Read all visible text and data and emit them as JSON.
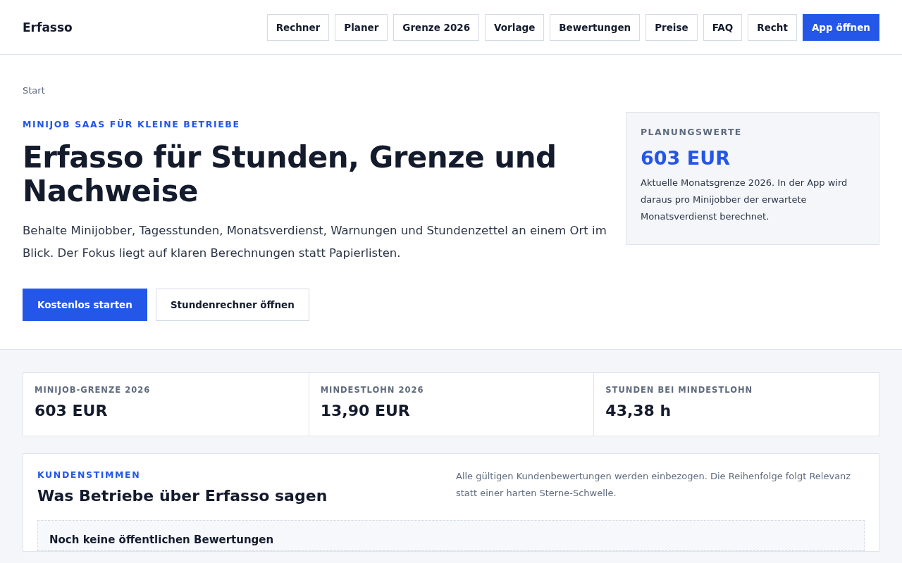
{
  "header": {
    "brand": "Erfasso",
    "nav": [
      {
        "label": "Rechner",
        "kind": "outline"
      },
      {
        "label": "Planer",
        "kind": "outline"
      },
      {
        "label": "Grenze 2026",
        "kind": "outline"
      },
      {
        "label": "Vorlage",
        "kind": "outline"
      },
      {
        "label": "Bewertungen",
        "kind": "outline"
      },
      {
        "label": "Preise",
        "kind": "outline"
      },
      {
        "label": "FAQ",
        "kind": "outline"
      },
      {
        "label": "Recht",
        "kind": "outline"
      },
      {
        "label": "App öffnen",
        "kind": "primary"
      }
    ]
  },
  "breadcrumb": "Start",
  "hero": {
    "eyebrow": "MINIJOB SAAS FÜR KLEINE BETRIEBE",
    "title": "Erfasso für Stunden, Grenze und Nachweise",
    "text": "Behalte Minijobber, Tagesstunden, Monatsverdienst, Warnungen und Stundenzettel an einem Ort im Blick. Der Fokus liegt auf klaren Berechnungen statt Papierlisten.",
    "buttons": [
      {
        "label": "Kostenlos starten",
        "kind": "primary"
      },
      {
        "label": "Stundenrechner öffnen",
        "kind": "outline"
      }
    ]
  },
  "planning_card": {
    "label": "PLANUNGSWERTE",
    "value": "603 EUR",
    "text": "Aktuelle Monatsgrenze 2026. In der App wird daraus pro Minijobber der erwartete Monatsverdienst berechnet."
  },
  "stats": [
    {
      "label": "MINIJOB-GRENZE 2026",
      "value": "603 EUR"
    },
    {
      "label": "MINDESTLOHN 2026",
      "value": "13,90 EUR"
    },
    {
      "label": "STUNDEN BEI MINDESTLOHN",
      "value": "43,38 h"
    }
  ],
  "reviews": {
    "eyebrow": "KUNDENSTIMMEN",
    "title": "Was Betriebe über Erfasso sagen",
    "note": "Alle gültigen Kundenbewertungen werden einbezogen. Die Reihenfolge folgt Relevanz statt einer harten Sterne-Schwelle.",
    "empty_title": "Noch keine öffentlichen Bewertungen"
  }
}
